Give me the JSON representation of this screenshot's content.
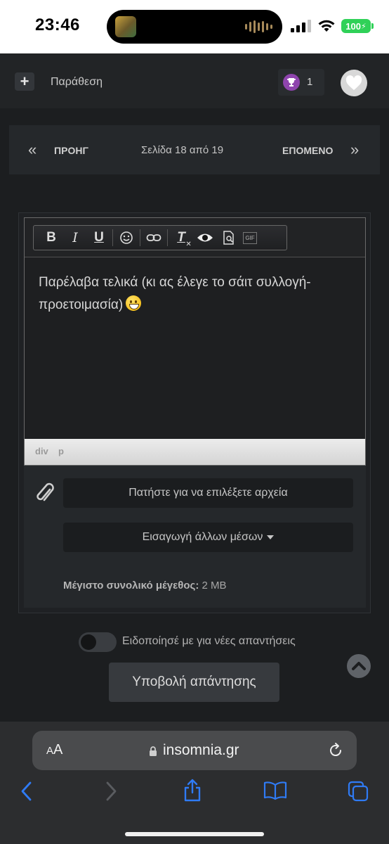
{
  "status_bar": {
    "time": "23:46",
    "battery": "100"
  },
  "action_bar": {
    "quote_plus": "+",
    "quote_label": "Παράθεση",
    "reaction_count": "1"
  },
  "pagination": {
    "prev_arrows": "«",
    "prev_label": "ΠΡΟΗΓ",
    "page_info": "Σελίδα 18 από 19",
    "next_label": "ΕΠΟΜΕΝΟ",
    "next_arrows": "»"
  },
  "editor": {
    "toolbar": {
      "bold": "B",
      "italic": "I",
      "underline": "U",
      "clear_format": "T",
      "gif": "GIF"
    },
    "content": "Παρέλαβα τελικά (κι ας έλεγε το σάιτ συλλογή-προετοιμασία)",
    "path": [
      "div",
      "p"
    ]
  },
  "attachments": {
    "select_files": "Πατήστε για να επιλέξετε αρχεία",
    "more_media": "Εισαγωγή άλλων μέσων",
    "max_size_label": "Μέγιστο συνολικό μέγεθος:",
    "max_size_value": "2 MB"
  },
  "notify": {
    "label": "Ειδοποίησέ με για νέες απαντήσεις",
    "enabled": false
  },
  "submit_label": "Υποβολή απάντησης",
  "safari": {
    "aa_small": "A",
    "aa_big": "A",
    "domain": "insomnia.gr"
  },
  "icons": {
    "trophy": "trophy-icon",
    "heart": "heart-icon",
    "paperclip": "paperclip-icon",
    "scroll_top": "chevron-up-icon",
    "lock": "lock-icon",
    "reload": "reload-icon",
    "back": "back-icon",
    "forward": "forward-icon",
    "share": "share-icon",
    "bookmarks": "book-icon",
    "tabs": "tabs-icon"
  },
  "colors": {
    "background": "#1c1e20",
    "accent_safari": "#2f7bf5",
    "trophy": "#8e44ad",
    "battery": "#30d158"
  }
}
